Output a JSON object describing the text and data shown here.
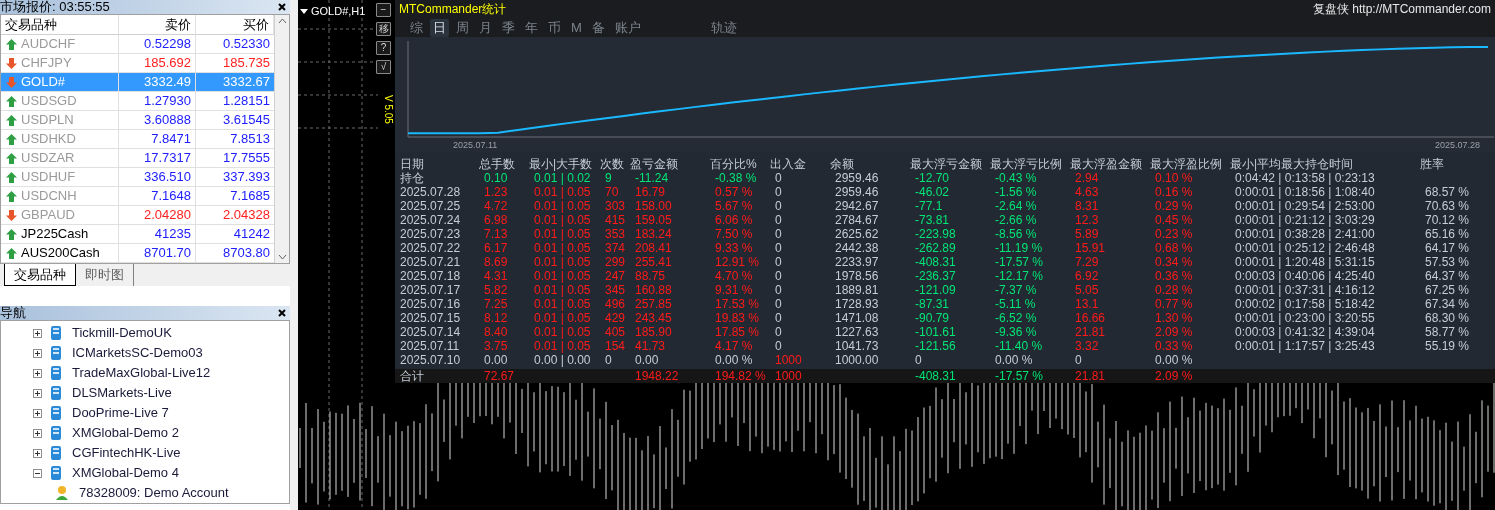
{
  "market_watch": {
    "title": "市场报价: 03:55:55",
    "columns": [
      "交易品种",
      "卖价",
      "买价"
    ],
    "rows": [
      {
        "symbol": "AUDCHF",
        "bid": "0.52298",
        "ask": "0.52330",
        "rising": true,
        "dimmed": true,
        "selected": false
      },
      {
        "symbol": "CHFJPY",
        "bid": "185.692",
        "ask": "185.735",
        "rising": false,
        "dimmed": true,
        "selected": false
      },
      {
        "symbol": "GOLD#",
        "bid": "3332.49",
        "ask": "3332.67",
        "rising": false,
        "dimmed": false,
        "selected": true
      },
      {
        "symbol": "USDSGD",
        "bid": "1.27930",
        "ask": "1.28151",
        "rising": true,
        "dimmed": true,
        "selected": false
      },
      {
        "symbol": "USDPLN",
        "bid": "3.60888",
        "ask": "3.61545",
        "rising": true,
        "dimmed": true,
        "selected": false
      },
      {
        "symbol": "USDHKD",
        "bid": "7.8471",
        "ask": "7.8513",
        "rising": true,
        "dimmed": true,
        "selected": false
      },
      {
        "symbol": "USDZAR",
        "bid": "17.7317",
        "ask": "17.7555",
        "rising": true,
        "dimmed": true,
        "selected": false
      },
      {
        "symbol": "USDHUF",
        "bid": "336.510",
        "ask": "337.393",
        "rising": true,
        "dimmed": true,
        "selected": false
      },
      {
        "symbol": "USDCNH",
        "bid": "7.1648",
        "ask": "7.1685",
        "rising": true,
        "dimmed": true,
        "selected": false
      },
      {
        "symbol": "GBPAUD",
        "bid": "2.04280",
        "ask": "2.04328",
        "rising": false,
        "dimmed": true,
        "selected": false
      },
      {
        "symbol": "JP225Cash",
        "bid": "41235",
        "ask": "41242",
        "rising": true,
        "dimmed": false,
        "selected": false
      },
      {
        "symbol": "AUS200Cash",
        "bid": "8701.70",
        "ask": "8703.80",
        "rising": true,
        "dimmed": false,
        "selected": false
      }
    ],
    "tabs": [
      {
        "label": "交易品种",
        "selected": true
      },
      {
        "label": "即时图",
        "selected": false
      }
    ]
  },
  "navigator": {
    "title": "导航",
    "items": [
      {
        "label": "Tickmill-DemoUK",
        "expanded": false
      },
      {
        "label": "ICMarketsSC-Demo03",
        "expanded": false
      },
      {
        "label": "TradeMaxGlobal-Live12",
        "expanded": false
      },
      {
        "label": "DLSMarkets-Live",
        "expanded": false
      },
      {
        "label": "DooPrime-Live 7",
        "expanded": false
      },
      {
        "label": "XMGlobal-Demo 2",
        "expanded": false
      },
      {
        "label": "CGFintechHK-Live",
        "expanded": false
      },
      {
        "label": "XMGlobal-Demo 4",
        "expanded": true,
        "children": [
          {
            "label": "78328009: Demo Account"
          }
        ]
      }
    ]
  },
  "chart": {
    "title": "GOLD#,H1",
    "buttons": [
      "−",
      "移",
      "?",
      "√"
    ],
    "version": "V 5.05"
  },
  "stats": {
    "title": "MTCommander统计",
    "brand": "复盘侠 http://MTCommander.com",
    "tabs": [
      {
        "label": "综",
        "selected": false
      },
      {
        "label": "日",
        "selected": true
      },
      {
        "label": "周",
        "selected": false
      },
      {
        "label": "月",
        "selected": false
      },
      {
        "label": "季",
        "selected": false
      },
      {
        "label": "年",
        "selected": false
      },
      {
        "label": "币",
        "selected": false
      },
      {
        "label": "M",
        "selected": false
      },
      {
        "label": "备",
        "selected": false
      },
      {
        "label": "账户",
        "selected": false
      },
      {
        "label": "轨迹",
        "selected": false
      }
    ],
    "equity_dates": [
      "2025.07.11",
      "2025.07.28"
    ],
    "columns": [
      "日期",
      "总手数",
      "最小|大手数",
      "次数",
      "盈亏金额",
      "百分比%",
      "出入金",
      "余额",
      "最大浮亏金额",
      "最大浮亏比例",
      "最大浮盈金额",
      "最大浮盈比例",
      "最小|平均最大持仓时间",
      "胜率"
    ],
    "rows": [
      {
        "kind": "open",
        "cells": [
          "持仓",
          "0.10",
          "0.01 | 0.02",
          "9",
          "-11.24",
          "-0.38 %",
          "0",
          "2959.46",
          "-12.70",
          "-0.43 %",
          "2.94",
          "0.10 %",
          "0:04:42 | 0:13:58 | 0:23:13",
          null
        ]
      },
      {
        "kind": "day",
        "cells": [
          "2025.07.28",
          "1.23",
          "0.01 | 0.05",
          "70",
          "16.79",
          "0.57 %",
          "0",
          "2959.46",
          "-46.02",
          "-1.56 %",
          "4.63",
          "0.16 %",
          "0:00:01 | 0:18:56 | 1:08:40",
          "68.57 %"
        ]
      },
      {
        "kind": "day",
        "cells": [
          "2025.07.25",
          "4.72",
          "0.01 | 0.05",
          "303",
          "158.00",
          "5.67 %",
          "0",
          "2942.67",
          "-77.1",
          "-2.64 %",
          "8.31",
          "0.29 %",
          "0:00:01 | 0:29:54 | 2:53:00",
          "70.63 %"
        ]
      },
      {
        "kind": "day",
        "cells": [
          "2025.07.24",
          "6.98",
          "0.01 | 0.05",
          "415",
          "159.05",
          "6.06 %",
          "0",
          "2784.67",
          "-73.81",
          "-2.66 %",
          "12.3",
          "0.45 %",
          "0:00:01 | 0:21:12 | 3:03:29",
          "70.12 %"
        ]
      },
      {
        "kind": "day",
        "cells": [
          "2025.07.23",
          "7.13",
          "0.01 | 0.05",
          "353",
          "183.24",
          "7.50 %",
          "0",
          "2625.62",
          "-223.98",
          "-8.56 %",
          "5.89",
          "0.23 %",
          "0:00:01 | 0:38:28 | 2:41:00",
          "65.16 %"
        ]
      },
      {
        "kind": "day",
        "cells": [
          "2025.07.22",
          "6.17",
          "0.01 | 0.05",
          "374",
          "208.41",
          "9.33 %",
          "0",
          "2442.38",
          "-262.89",
          "-11.19 %",
          "15.91",
          "0.68 %",
          "0:00:01 | 0:25:12 | 2:46:48",
          "64.17 %"
        ]
      },
      {
        "kind": "day",
        "cells": [
          "2025.07.21",
          "8.69",
          "0.01 | 0.05",
          "299",
          "255.41",
          "12.91 %",
          "0",
          "2233.97",
          "-408.31",
          "-17.57 %",
          "7.29",
          "0.34 %",
          "0:00:01 | 1:20:48 | 5:31:15",
          "57.53 %"
        ]
      },
      {
        "kind": "day",
        "cells": [
          "2025.07.18",
          "4.31",
          "0.01 | 0.05",
          "247",
          "88.75",
          "4.70 %",
          "0",
          "1978.56",
          "-236.37",
          "-12.17 %",
          "6.92",
          "0.36 %",
          "0:00:03 | 0:40:06 | 4:25:40",
          "64.37 %"
        ]
      },
      {
        "kind": "day",
        "cells": [
          "2025.07.17",
          "5.82",
          "0.01 | 0.05",
          "345",
          "160.88",
          "9.31 %",
          "0",
          "1889.81",
          "-121.09",
          "-7.37 %",
          "5.05",
          "0.28 %",
          "0:00:01 | 0:37:31 | 4:16:12",
          "67.25 %"
        ]
      },
      {
        "kind": "day",
        "cells": [
          "2025.07.16",
          "7.25",
          "0.01 | 0.05",
          "496",
          "257.85",
          "17.53 %",
          "0",
          "1728.93",
          "-87.31",
          "-5.11 %",
          "13.1",
          "0.77 %",
          "0:00:02 | 0:17:58 | 5:18:42",
          "67.34 %"
        ]
      },
      {
        "kind": "day",
        "cells": [
          "2025.07.15",
          "8.12",
          "0.01 | 0.05",
          "429",
          "243.45",
          "19.83 %",
          "0",
          "1471.08",
          "-90.79",
          "-6.52 %",
          "16.66",
          "1.30 %",
          "0:00:01 | 0:23:00 | 3:20:55",
          "68.30 %"
        ]
      },
      {
        "kind": "day",
        "cells": [
          "2025.07.14",
          "8.40",
          "0.01 | 0.05",
          "405",
          "185.90",
          "17.85 %",
          "0",
          "1227.63",
          "-101.61",
          "-9.36 %",
          "21.81",
          "2.09 %",
          "0:00:03 | 0:41:32 | 4:39:04",
          "58.77 %"
        ]
      },
      {
        "kind": "day",
        "cells": [
          "2025.07.11",
          "3.75",
          "0.01 | 0.05",
          "154",
          "41.73",
          "4.17 %",
          "0",
          "1041.73",
          "-121.56",
          "-11.40 %",
          "3.32",
          "0.33 %",
          "0:00:01 | 1:17:57 | 3:25:43",
          "55.19 %"
        ]
      },
      {
        "kind": "deposit",
        "cells": [
          "2025.07.10",
          "0.00",
          "0.00 | 0.00",
          "0",
          "0.00",
          "0.00 %",
          "1000",
          "1000.00",
          "0",
          "0.00 %",
          "0",
          "0.00 %",
          null,
          null
        ]
      },
      {
        "kind": "total",
        "cells": [
          "合计",
          "72.67",
          null,
          null,
          "1948.22",
          "194.82 %",
          "1000",
          null,
          "-408.31",
          "-17.57 %",
          "21.81",
          "2.09 %",
          null,
          null
        ]
      }
    ]
  }
}
